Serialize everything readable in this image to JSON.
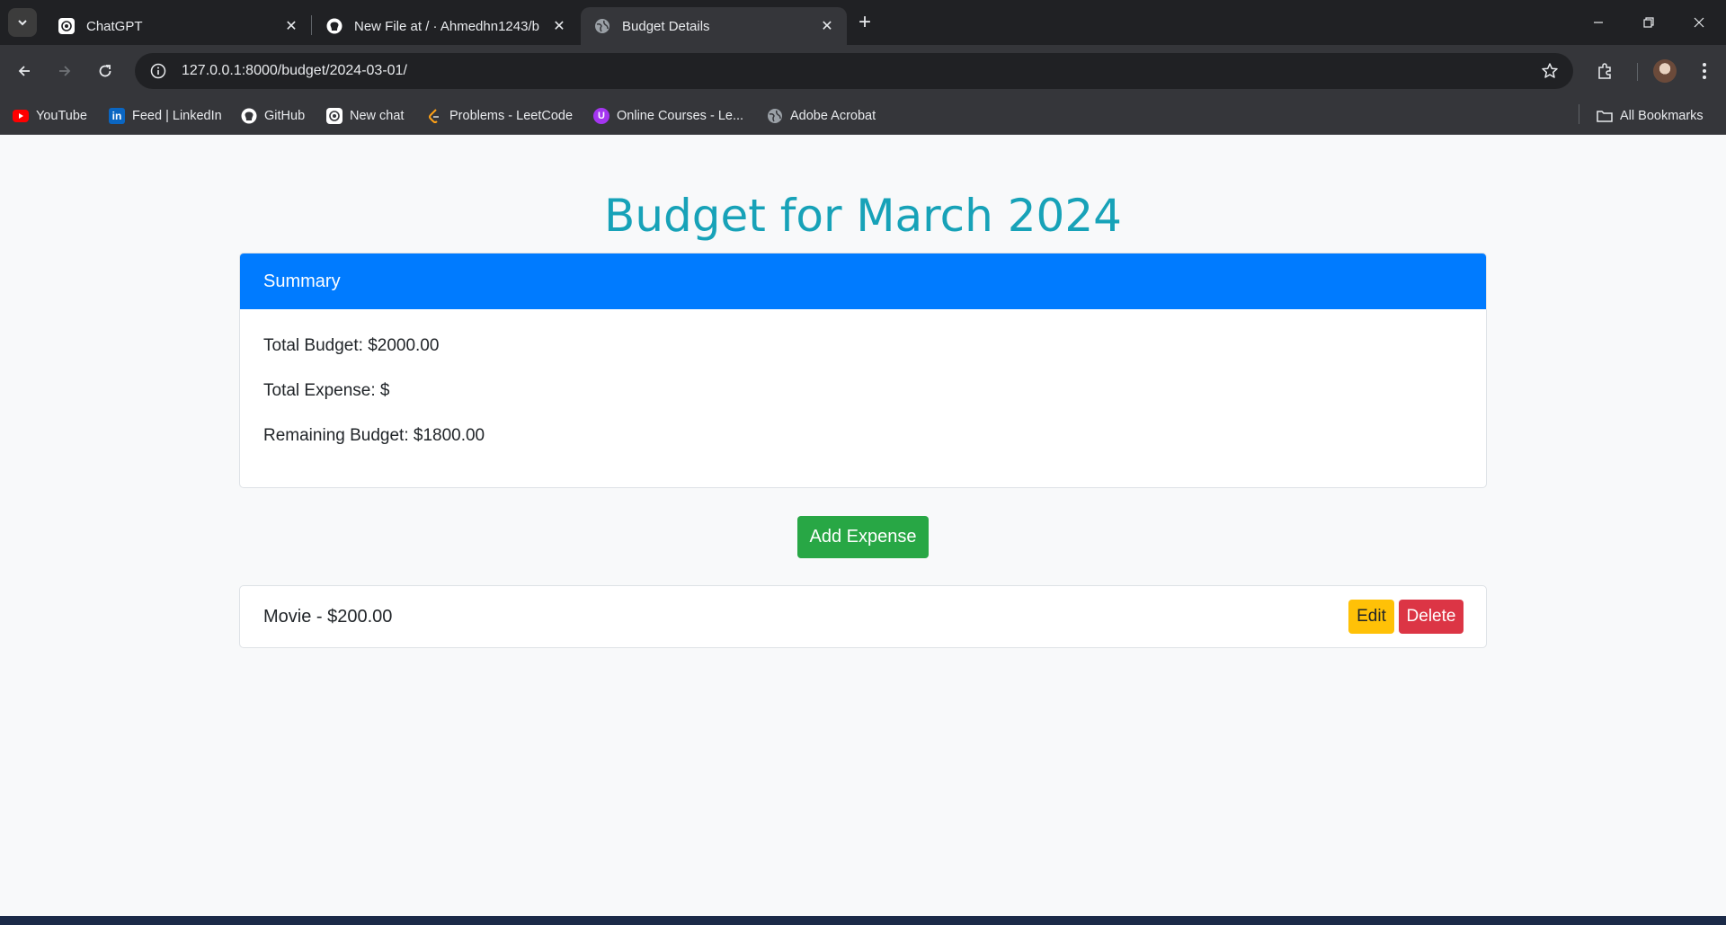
{
  "browser": {
    "tabs": [
      {
        "title": "ChatGPT",
        "icon": "chatgpt-icon"
      },
      {
        "title": "New File at / · Ahmedhn1243/b",
        "icon": "github-icon"
      },
      {
        "title": "Budget Details",
        "icon": "globe-icon"
      }
    ],
    "active_tab": 2,
    "url": "127.0.0.1:8000/budget/2024-03-01/",
    "bookmarks": [
      {
        "label": "YouTube",
        "icon": "youtube-icon",
        "color": "#ff0000"
      },
      {
        "label": "Feed | LinkedIn",
        "icon": "linkedin-icon",
        "color": "#0a66c2"
      },
      {
        "label": "GitHub",
        "icon": "github-icon",
        "color": "#ffffff"
      },
      {
        "label": "New chat",
        "icon": "chatgpt-icon",
        "color": "#ffffff"
      },
      {
        "label": "Problems - LeetCode",
        "icon": "leetcode-icon",
        "color": "#ffa116"
      },
      {
        "label": "Online Courses - Le...",
        "icon": "udemy-icon",
        "color": "#a435f0"
      },
      {
        "label": "Adobe Acrobat",
        "icon": "globe-icon",
        "color": "#9aa0a6"
      }
    ],
    "all_bookmarks_label": "All Bookmarks"
  },
  "page": {
    "title": "Budget for March 2024",
    "summary": {
      "header": "Summary",
      "total_budget": "Total Budget: $2000.00",
      "total_expense": "Total Expense: $",
      "remaining_budget": "Remaining Budget: $1800.00"
    },
    "add_expense_label": "Add Expense",
    "expenses": [
      {
        "text": "Movie - $200.00",
        "edit_label": "Edit",
        "delete_label": "Delete"
      }
    ]
  },
  "colors": {
    "title": "#17a2b8",
    "card_header": "#007bff",
    "add_button": "#28a745",
    "edit_button": "#ffc107",
    "delete_button": "#dc3545"
  }
}
